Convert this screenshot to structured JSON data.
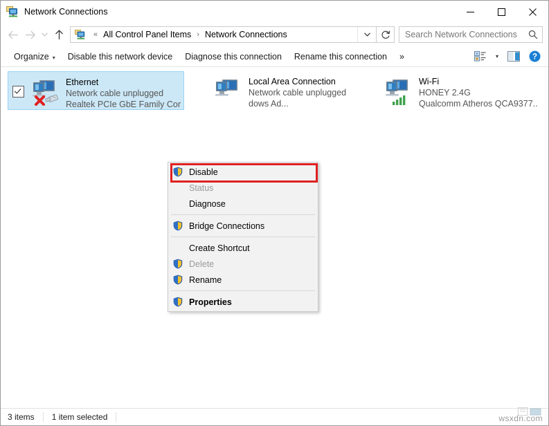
{
  "window": {
    "title": "Network Connections",
    "title_icon": "network-connections-icon",
    "minimize_label": "–",
    "maximize_label": "☐",
    "close_label": "✕"
  },
  "addressbar": {
    "back_icon": "back-arrow-icon",
    "forward_icon": "forward-arrow-icon",
    "recent_icon": "chevron-down-icon",
    "up_icon": "up-arrow-icon",
    "path_icon": "network-connections-icon",
    "overflow": "«",
    "crumbs": [
      {
        "label": "All Control Panel Items"
      },
      {
        "label": "Network Connections"
      }
    ],
    "separator": "›",
    "dropdown_icon": "chevron-down-icon",
    "refresh_icon": "refresh-icon"
  },
  "search": {
    "placeholder": "Search Network Connections",
    "icon": "search-icon"
  },
  "commandbar": {
    "items": [
      {
        "label": "Organize",
        "has_caret": true
      },
      {
        "label": "Disable this network device",
        "has_caret": false
      },
      {
        "label": "Diagnose this connection",
        "has_caret": false
      },
      {
        "label": "Rename this connection",
        "has_caret": false
      },
      {
        "label": "»",
        "has_caret": false
      }
    ],
    "caret": "▾",
    "view_icon": "view-options-icon",
    "view_caret": "▾",
    "preview_pane_icon": "preview-pane-icon",
    "help_icon": "help-icon"
  },
  "connections": [
    {
      "name": "Ethernet",
      "status": "Network cable unplugged",
      "device": "Realtek PCIe GbE Family Cor",
      "icon": "network-adapter-disconnected-icon",
      "selected": true,
      "checkbox": true
    },
    {
      "name": "Local Area Connection",
      "status": "Network cable unplugged",
      "device": "dows Ad...",
      "icon": "network-adapter-disconnected-icon",
      "selected": false,
      "checkbox": false
    },
    {
      "name": "Wi-Fi",
      "status": "HONEY 2.4G",
      "device": "Qualcomm Atheros QCA9377...",
      "icon": "wireless-adapter-connected-icon",
      "selected": false,
      "checkbox": false
    }
  ],
  "context_menu": {
    "items": [
      {
        "label": "Disable",
        "shield": true,
        "disabled": false,
        "bold": false,
        "separator_after": false
      },
      {
        "label": "Status",
        "shield": false,
        "disabled": true,
        "bold": false,
        "separator_after": false
      },
      {
        "label": "Diagnose",
        "shield": false,
        "disabled": false,
        "bold": false,
        "separator_after": true
      },
      {
        "label": "Bridge Connections",
        "shield": true,
        "disabled": false,
        "bold": false,
        "separator_after": true
      },
      {
        "label": "Create Shortcut",
        "shield": false,
        "disabled": false,
        "bold": false,
        "separator_after": false
      },
      {
        "label": "Delete",
        "shield": true,
        "disabled": true,
        "bold": false,
        "separator_after": false
      },
      {
        "label": "Rename",
        "shield": true,
        "disabled": false,
        "bold": false,
        "separator_after": true
      },
      {
        "label": "Properties",
        "shield": true,
        "disabled": false,
        "bold": true,
        "separator_after": false
      }
    ]
  },
  "highlight": {
    "color": "#e02020",
    "target": "Disable"
  },
  "statusbar": {
    "item_count": "3 items",
    "selection": "1 item selected"
  },
  "watermark": {
    "text": "wsxdn.com"
  },
  "colors": {
    "selection_fill": "#cce8f7",
    "selection_border": "#99d1f2",
    "menu_bg": "#f2f2f2",
    "accent_red": "#e02020",
    "help_blue": "#1a7fd4"
  }
}
